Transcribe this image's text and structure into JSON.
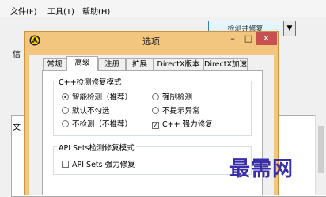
{
  "menubar": {
    "items": [
      "文件(F)",
      "工具(T)",
      "帮助(H)"
    ]
  },
  "background": {
    "left_label_1": "信",
    "left_label_2": "文",
    "top_button_label": "检测并修复",
    "dropdown_glyph": "▼"
  },
  "dialog": {
    "title": "选项",
    "min_glyph": "–",
    "max_glyph": "□",
    "close_glyph": "✕",
    "tabs": [
      "常规",
      "高级",
      "注册",
      "扩展",
      "DirectX版本",
      "DirectX加速"
    ],
    "active_tab": "高级",
    "cpp_group": {
      "title": "C++检测修复模式",
      "options": {
        "smart": "智能检测（推荐）",
        "force": "强制检测",
        "default_unchecked": "默认不勾选",
        "no_prompt": "不提示异常",
        "no_detect": "不检测（不推荐）",
        "strong_repair": "C++ 强力修复"
      },
      "selected_left": "智能检测（推荐）",
      "strong_repair_checked": true
    },
    "api_group": {
      "title": "API Sets检测修复模式",
      "checkbox_label": "API Sets 强力修复",
      "checked": false
    }
  },
  "watermark": "最需网"
}
